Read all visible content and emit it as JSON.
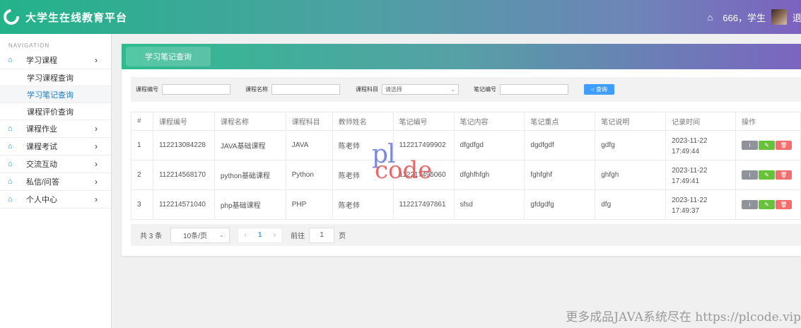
{
  "app": {
    "title": "大学生在线教育平台"
  },
  "topbar": {
    "user_text": "666，学生",
    "logout": "退出"
  },
  "sidebar": {
    "heading": "NAVIGATION",
    "items": [
      {
        "label": "学习课程",
        "icon": "home-icon"
      },
      {
        "label": "课程作业",
        "icon": "home-icon"
      },
      {
        "label": "课程考试",
        "icon": "home-icon"
      },
      {
        "label": "交流互动",
        "icon": "home-icon"
      },
      {
        "label": "私信/问答",
        "icon": "home-icon"
      },
      {
        "label": "个人中心",
        "icon": "home-icon"
      }
    ],
    "sub_items": [
      "学习课程查询",
      "学习笔记查询",
      "课程评价查询"
    ],
    "active_sub": "学习笔记查询"
  },
  "page": {
    "tab": "学习笔记查询"
  },
  "search": {
    "course_no_label": "课程编号",
    "course_name_label": "课程名称",
    "subject_label": "课程科目",
    "subject_placeholder": "请选择",
    "note_no_label": "笔记编号",
    "button": "查询"
  },
  "table": {
    "headers": [
      "#",
      "课程编号",
      "课程名称",
      "课程科目",
      "教师姓名",
      "笔记编号",
      "笔记内容",
      "笔记重点",
      "笔记说明",
      "记录时间",
      "操作"
    ],
    "rows": [
      {
        "idx": "1",
        "course_no": "112213084228",
        "course_name": "JAVA基础课程",
        "subject": "JAVA",
        "teacher": "陈老师",
        "note_no": "112217499902",
        "content": "dfgdfgd",
        "key": "dgdfgdf",
        "desc": "gdfg",
        "time": "2023-11-22 17:49:44"
      },
      {
        "idx": "2",
        "course_no": "112214568170",
        "course_name": "python基础课程",
        "subject": "Python",
        "teacher": "陈老师",
        "note_no": "112217495060",
        "content": "dfghfhfgh",
        "key": "fghfghf",
        "desc": "ghfgh",
        "time": "2023-11-22 17:49:41"
      },
      {
        "idx": "3",
        "course_no": "112214571040",
        "course_name": "php基础课程",
        "subject": "PHP",
        "teacher": "陈老师",
        "note_no": "112217497861",
        "content": "sfsd",
        "key": "gfdgdfg",
        "desc": "dfg",
        "time": "2023-11-22 17:49:37"
      }
    ],
    "actions": {
      "info": "i",
      "edit": "✎",
      "delete": "🗑"
    }
  },
  "pager": {
    "total": "共 3 条",
    "page_size": "10条/页",
    "current": "1",
    "goto": "前往",
    "jump_value": "1",
    "unit": "页"
  },
  "watermark": {
    "a": "pl",
    "b": "code"
  },
  "footer_note": "更多成品JAVA系统尽在 https://plcode.vip"
}
